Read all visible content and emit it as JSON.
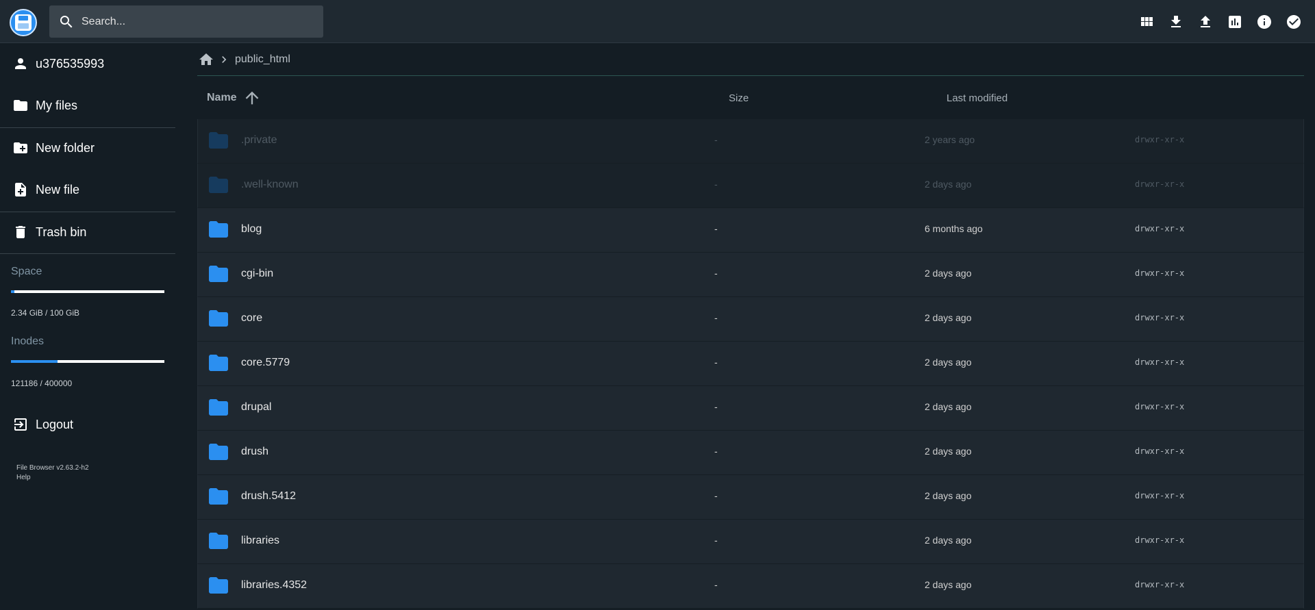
{
  "header": {
    "search_placeholder": "Search...",
    "actions": [
      {
        "icon": "grid-view-icon",
        "name": "switch-view-button"
      },
      {
        "icon": "download-icon",
        "name": "download-button"
      },
      {
        "icon": "upload-icon",
        "name": "upload-button"
      },
      {
        "icon": "chart-icon",
        "name": "disk-usage-button"
      },
      {
        "icon": "info-icon",
        "name": "info-button"
      },
      {
        "icon": "check-circle-icon",
        "name": "select-multiple-button"
      }
    ]
  },
  "sidebar": {
    "user": "u376535993",
    "my_files": "My files",
    "new_folder": "New folder",
    "new_file": "New file",
    "trash_bin": "Trash bin",
    "space": {
      "title": "Space",
      "text": "2.34 GiB / 100 GiB",
      "fraction": 0.0234
    },
    "inodes": {
      "title": "Inodes",
      "text": "121186 / 400000",
      "fraction": 0.303
    },
    "logout": "Logout",
    "version": "File Browser v2.63.2-h2",
    "help": "Help"
  },
  "breadcrumbs": [
    "public_html"
  ],
  "list_header": {
    "name": "Name",
    "size": "Size",
    "modified": "Last modified"
  },
  "accent_color": "#2b8ff0",
  "files": [
    {
      "name": ".private",
      "size": "-",
      "modified": "2 years ago",
      "perm": "drwxr-xr-x",
      "hidden": true
    },
    {
      "name": ".well-known",
      "size": "-",
      "modified": "2 days ago",
      "perm": "drwxr-xr-x",
      "hidden": true
    },
    {
      "name": "blog",
      "size": "-",
      "modified": "6 months ago",
      "perm": "drwxr-xr-x",
      "hidden": false
    },
    {
      "name": "cgi-bin",
      "size": "-",
      "modified": "2 days ago",
      "perm": "drwxr-xr-x",
      "hidden": false
    },
    {
      "name": "core",
      "size": "-",
      "modified": "2 days ago",
      "perm": "drwxr-xr-x",
      "hidden": false
    },
    {
      "name": "core.5779",
      "size": "-",
      "modified": "2 days ago",
      "perm": "drwxr-xr-x",
      "hidden": false
    },
    {
      "name": "drupal",
      "size": "-",
      "modified": "2 days ago",
      "perm": "drwxr-xr-x",
      "hidden": false
    },
    {
      "name": "drush",
      "size": "-",
      "modified": "2 days ago",
      "perm": "drwxr-xr-x",
      "hidden": false
    },
    {
      "name": "drush.5412",
      "size": "-",
      "modified": "2 days ago",
      "perm": "drwxr-xr-x",
      "hidden": false
    },
    {
      "name": "libraries",
      "size": "-",
      "modified": "2 days ago",
      "perm": "drwxr-xr-x",
      "hidden": false
    },
    {
      "name": "libraries.4352",
      "size": "-",
      "modified": "2 days ago",
      "perm": "drwxr-xr-x",
      "hidden": false
    }
  ]
}
